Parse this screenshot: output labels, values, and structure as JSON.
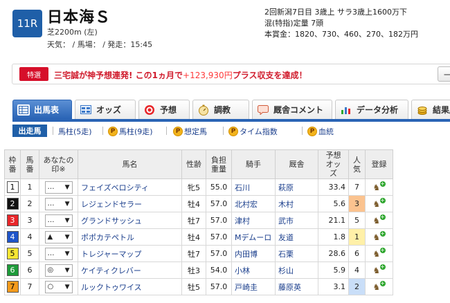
{
  "race": {
    "number": "11R",
    "name": "日本海Ｓ",
    "course": "芝2200m (左)",
    "weather": "天気： / 馬場： / 発走：15:45",
    "meta_line1": "2回新潟7日目 3歳上 サラ3歳上1600万下",
    "meta_line2": "混(特指)定量 7頭",
    "meta_line3": "本賞金：1820、730、460、270、182万円"
  },
  "banner": {
    "tag": "特選",
    "text_before": "三宅誠が神予想連発! この1ヵ月で",
    "amount": "+123,930円",
    "text_after": "プラス収支を達成！",
    "button": "一覧"
  },
  "tabs": [
    {
      "label": "出馬表",
      "icon": "table-icon"
    },
    {
      "label": "オッズ",
      "icon": "grid-icon"
    },
    {
      "label": "予想",
      "icon": "target-icon"
    },
    {
      "label": "調教",
      "icon": "stopwatch-icon"
    },
    {
      "label": "厩舎コメント",
      "icon": "comment-icon"
    },
    {
      "label": "データ分析",
      "icon": "bar-chart-icon"
    },
    {
      "label": "結果/払",
      "icon": "coins-icon"
    }
  ],
  "subnav": {
    "active": "出走馬",
    "items": [
      "馬柱(5走)",
      "馬柱(9走)",
      "想定馬",
      "タイム指数",
      "血統"
    ]
  },
  "table": {
    "headers": {
      "waku": "枠番",
      "umaban": "馬番",
      "mark": "あなたの印※",
      "name": "馬名",
      "sexage": "性齢",
      "weight": "負担重量",
      "jockey": "騎手",
      "trainer": "厩舎",
      "odds": "予想オッズ",
      "pop": "人気",
      "reg": "登録"
    },
    "rows": [
      {
        "waku": "1",
        "umaban": "1",
        "mark": "…",
        "name": "フェイズベロシティ",
        "sexage": "牝5",
        "weight": "55.0",
        "jockey": "石川",
        "trainer": "萩原",
        "odds": "33.4",
        "pop": "7"
      },
      {
        "waku": "2",
        "umaban": "2",
        "mark": "…",
        "name": "レジェンドセラー",
        "sexage": "牡4",
        "weight": "57.0",
        "jockey": "北村宏",
        "trainer": "木村",
        "odds": "5.6",
        "pop": "3"
      },
      {
        "waku": "3",
        "umaban": "3",
        "mark": "…",
        "name": "グランドサッシュ",
        "sexage": "牡7",
        "weight": "57.0",
        "jockey": "津村",
        "trainer": "武市",
        "odds": "21.1",
        "pop": "5"
      },
      {
        "waku": "4",
        "umaban": "4",
        "mark": "▲",
        "name": "ポポカテペトル",
        "sexage": "牡4",
        "weight": "57.0",
        "jockey": "Mデムーロ",
        "trainer": "友道",
        "odds": "1.8",
        "pop": "1"
      },
      {
        "waku": "5",
        "umaban": "5",
        "mark": "…",
        "name": "トレジャーマップ",
        "sexage": "牡7",
        "weight": "57.0",
        "jockey": "内田博",
        "trainer": "石栗",
        "odds": "28.6",
        "pop": "6"
      },
      {
        "waku": "6",
        "umaban": "6",
        "mark": "◎",
        "name": "ケイティクレバー",
        "sexage": "牡3",
        "weight": "54.0",
        "jockey": "小林",
        "trainer": "杉山",
        "odds": "5.9",
        "pop": "4"
      },
      {
        "waku": "7",
        "umaban": "7",
        "mark": "○",
        "name": "ルックトゥワイス",
        "sexage": "牡5",
        "weight": "57.0",
        "jockey": "戸崎圭",
        "trainer": "藤原英",
        "odds": "3.1",
        "pop": "2"
      }
    ]
  },
  "colors": {
    "brand_blue": "#1f5fa8",
    "banner_red": "#d01b2c",
    "waku1": "#ffffff",
    "waku2": "#111111",
    "waku3": "#e8262a",
    "waku4": "#1f55c9",
    "waku5": "#f7e633",
    "waku6": "#1e9b3a",
    "waku7": "#f39a1c",
    "pop1": "#fff0a8",
    "pop2": "#c9def8",
    "pop3": "#fbc38f"
  }
}
